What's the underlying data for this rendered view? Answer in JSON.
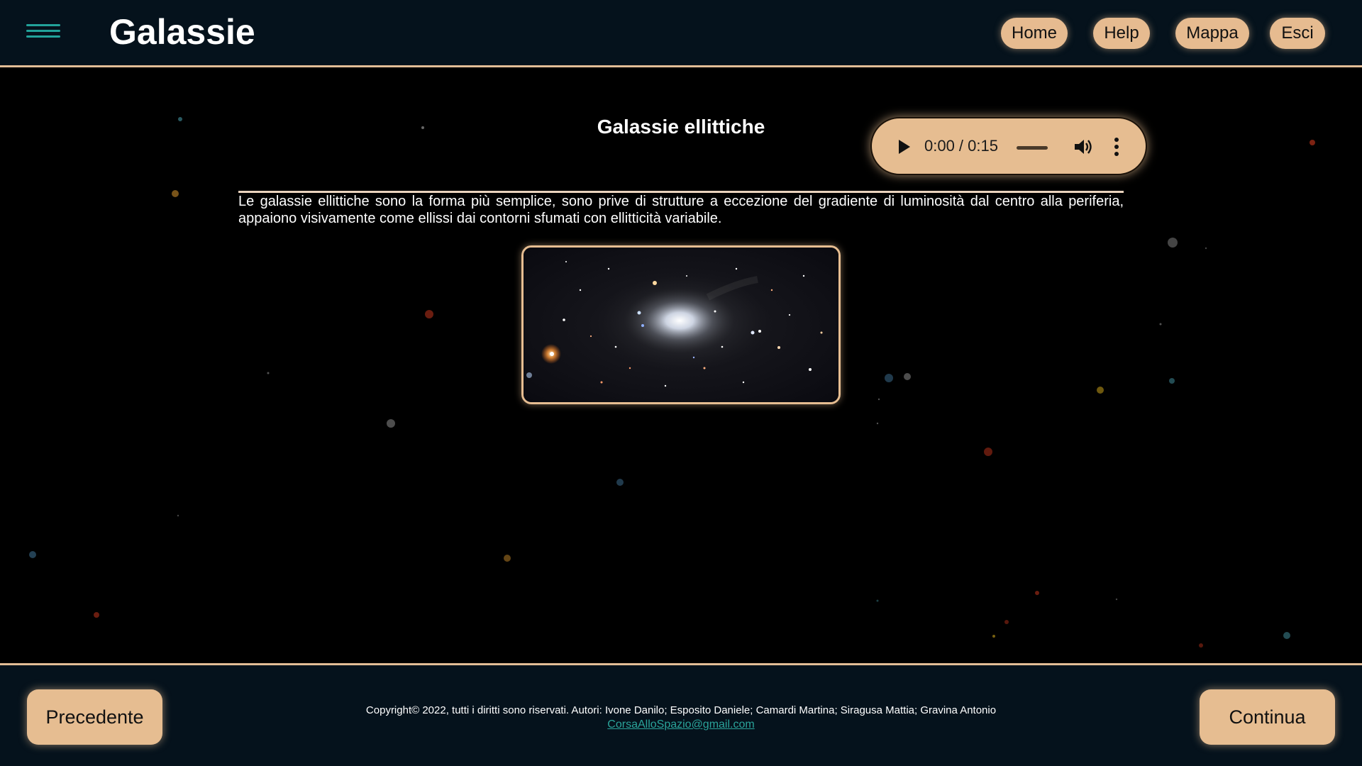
{
  "header": {
    "title": "Galassie",
    "menu_icon": "hamburger-menu-icon",
    "nav": {
      "home": "Home",
      "help": "Help",
      "map": "Mappa",
      "exit": "Esci"
    }
  },
  "main": {
    "section_title": "Galassie ellittiche",
    "audio": {
      "time": "0:00 / 0:15",
      "play_icon": "play-icon",
      "volume_icon": "volume-icon",
      "more_icon": "more-vertical-icon"
    },
    "description": "Le galassie ellittiche sono la forma più semplice, sono prive di strutture a eccezione del gradiente di luminosità dal centro alla periferia, appaiono visivamente come ellissi dai contorni sfumati con ellitticità variabile.",
    "image_subject": "elliptical-galaxy-image"
  },
  "footer": {
    "prev": "Precedente",
    "next": "Continua",
    "copyright": "Copyright© 2022, tutti i diritti sono riservati. Autori: Ivone Danilo; Esposito Daniele; Camardi Martina; Siragusa Mattia; Gravina Antonio",
    "email": "CorsaAlloSpazio@gmail.com"
  },
  "colors": {
    "accent": "#e6bd91",
    "header_bg": "#05121c",
    "menu_icon": "#22a39a",
    "link": "#2aa39a"
  }
}
